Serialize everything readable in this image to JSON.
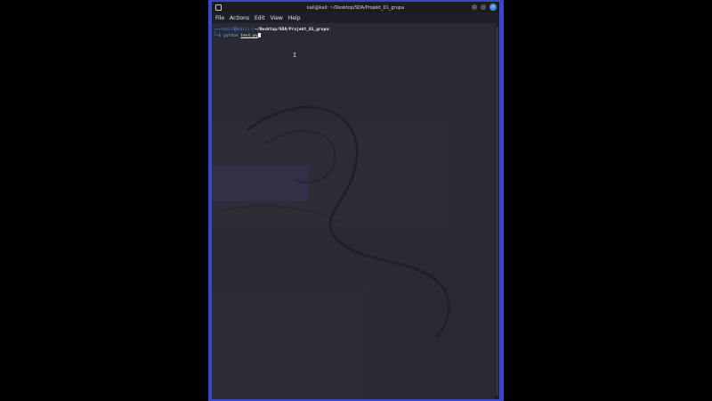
{
  "window": {
    "title": "kali@kali: ~/Desktop/SDA/Projekt_01_grupa"
  },
  "menu": {
    "items": [
      "File",
      "Actions",
      "Edit",
      "View",
      "Help"
    ]
  },
  "terminal": {
    "prompt_frame_top": "┌──(",
    "user_host": "kali㉿kali",
    "prompt_sep": ")-[",
    "cwd": "~/Desktop/SDA/Projekt_01_grupa",
    "prompt_close": "]",
    "prompt_frame_bottom": "└─$ ",
    "command": "python",
    "argument": "test.py"
  },
  "colors": {
    "window_border": "#3a47c8",
    "terminal_bg": "#2a2a34",
    "prompt_accent": "#3fa0ff"
  }
}
